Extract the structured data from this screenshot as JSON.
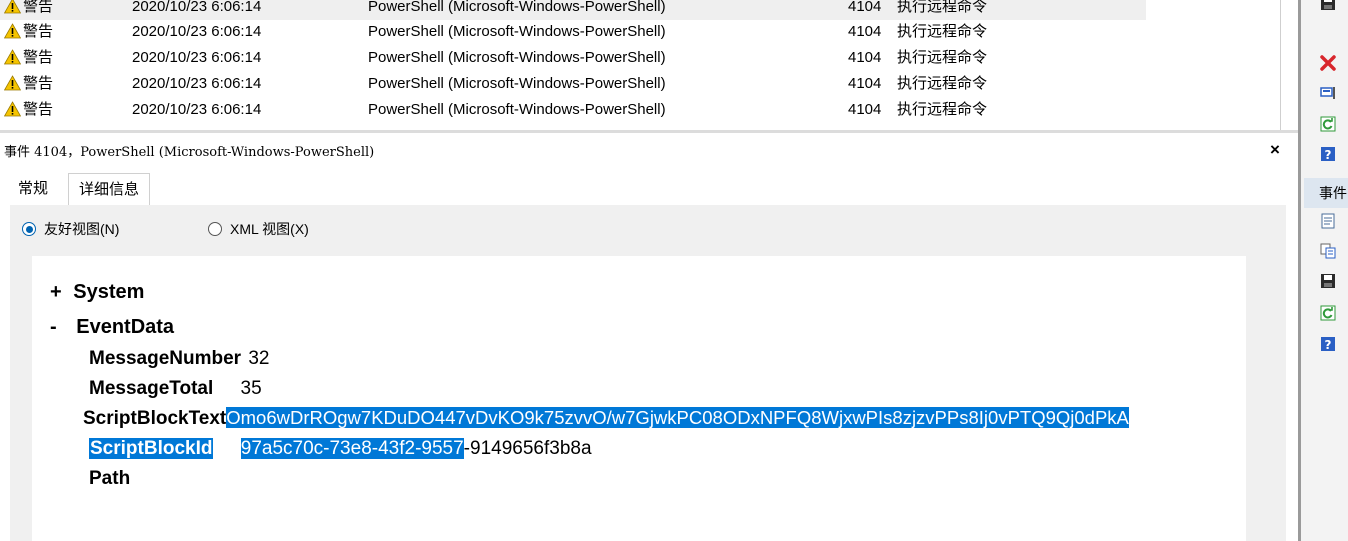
{
  "events": [
    {
      "level": "警告",
      "datetime": "2020/10/23 6:06:14",
      "source": "PowerShell (Microsoft-Windows-PowerShell)",
      "event_id": "4104",
      "task": "执行远程命令"
    },
    {
      "level": "警告",
      "datetime": "2020/10/23 6:06:14",
      "source": "PowerShell (Microsoft-Windows-PowerShell)",
      "event_id": "4104",
      "task": "执行远程命令"
    },
    {
      "level": "警告",
      "datetime": "2020/10/23 6:06:14",
      "source": "PowerShell (Microsoft-Windows-PowerShell)",
      "event_id": "4104",
      "task": "执行远程命令"
    },
    {
      "level": "警告",
      "datetime": "2020/10/23 6:06:14",
      "source": "PowerShell (Microsoft-Windows-PowerShell)",
      "event_id": "4104",
      "task": "执行远程命令"
    },
    {
      "level": "警告",
      "datetime": "2020/10/23 6:06:14",
      "source": "PowerShell (Microsoft-Windows-PowerShell)",
      "event_id": "4104",
      "task": "执行远程命令"
    }
  ],
  "detail": {
    "title": "事件 4104，PowerShell (Microsoft-Windows-PowerShell)",
    "close_label": "×"
  },
  "tabs": {
    "general": "常规",
    "details": "详细信息"
  },
  "view_options": {
    "friendly": "友好视图(N)",
    "xml": "XML 视图(X)"
  },
  "event_xml": {
    "system_toggle": "+",
    "system_label": "System",
    "eventdata_toggle": "-",
    "eventdata_label": "EventData",
    "message_number_key": "MessageNumber",
    "message_number_value": "32",
    "message_total_key": "MessageTotal",
    "message_total_value": "35",
    "script_block_text_key": "ScriptBlockText",
    "script_block_text_value": "Omo6wDrROgw7KDuDO447vDvKO9k75zvvO/w7GjwkPC08ODxNPFQ8WjxwPIs8zjzvPPs8Ij0vPTQ9Qj0dPkA",
    "script_block_id_key": "ScriptBlockId",
    "script_block_id_selected": "97a5c70c-73e8-43f2-9557",
    "script_block_id_rest": "-9149656f3b8a",
    "path_key": "Path"
  },
  "actions_panel": {
    "section_label": "事件"
  },
  "icons": {
    "warning": "warning-icon",
    "delete": "delete-icon",
    "attach": "attach-task-icon",
    "refresh": "refresh-icon",
    "help": "help-icon",
    "properties": "event-properties-icon",
    "copy": "copy-icon",
    "save": "save-icon"
  },
  "colors": {
    "selection": "#0078d7",
    "warning_yellow": "#f5c400",
    "delete_red": "#d8262c",
    "help_blue": "#2a5fc4",
    "refresh_green": "#2f9a3a"
  }
}
